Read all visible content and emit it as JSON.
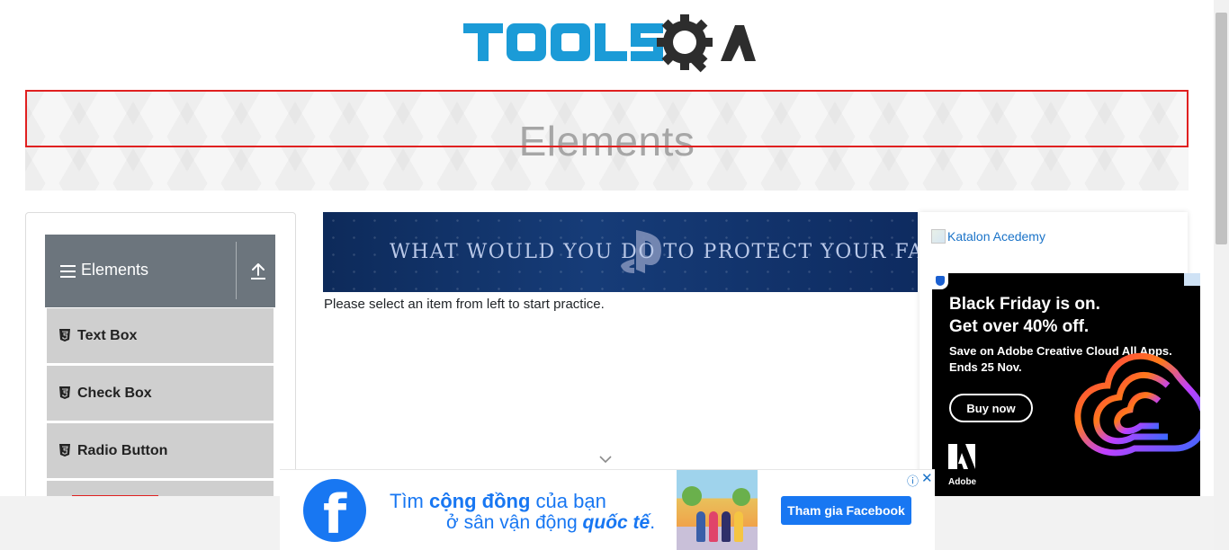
{
  "header": {
    "logo_text": "TOOLSQA"
  },
  "banner": {
    "title": "Elements"
  },
  "sidebar": {
    "group": {
      "label": "Elements"
    },
    "items": [
      {
        "label": "Text Box"
      },
      {
        "label": "Check Box"
      },
      {
        "label": "Radio Button"
      }
    ]
  },
  "main": {
    "ad_banner_text": "WHAT WOULD YOU DO TO PROTECT YOUR FAMILY?",
    "intro": "Please select an item from left to start practice."
  },
  "right_column": {
    "link_text": "Katalon Acedemy",
    "adobe_ad": {
      "headline_1": "Black Friday is on.",
      "headline_2": "Get over 40% off.",
      "body_1": "Save on Adobe Creative Cloud All Apps.",
      "body_2": "Ends 25 Nov.",
      "button": "Buy now",
      "brand": "Adobe"
    }
  },
  "bottom_ad": {
    "line1_pre": "Tìm ",
    "line1_bold": "cộng đồng",
    "line1_post": " của bạn",
    "line2_pre": "ở sân vận động ",
    "line2_bold": "quốc tế",
    "line2_post": ".",
    "button": "Tham gia Facebook",
    "info_icon": "ⓘ",
    "close_icon": "✕"
  },
  "colors": {
    "brand_blue": "#1b9bd7",
    "sidebar_header": "#6c757d",
    "menu_item_bg": "#cfcfcf",
    "highlight_border": "#e02020",
    "facebook_blue": "#1877f2"
  }
}
